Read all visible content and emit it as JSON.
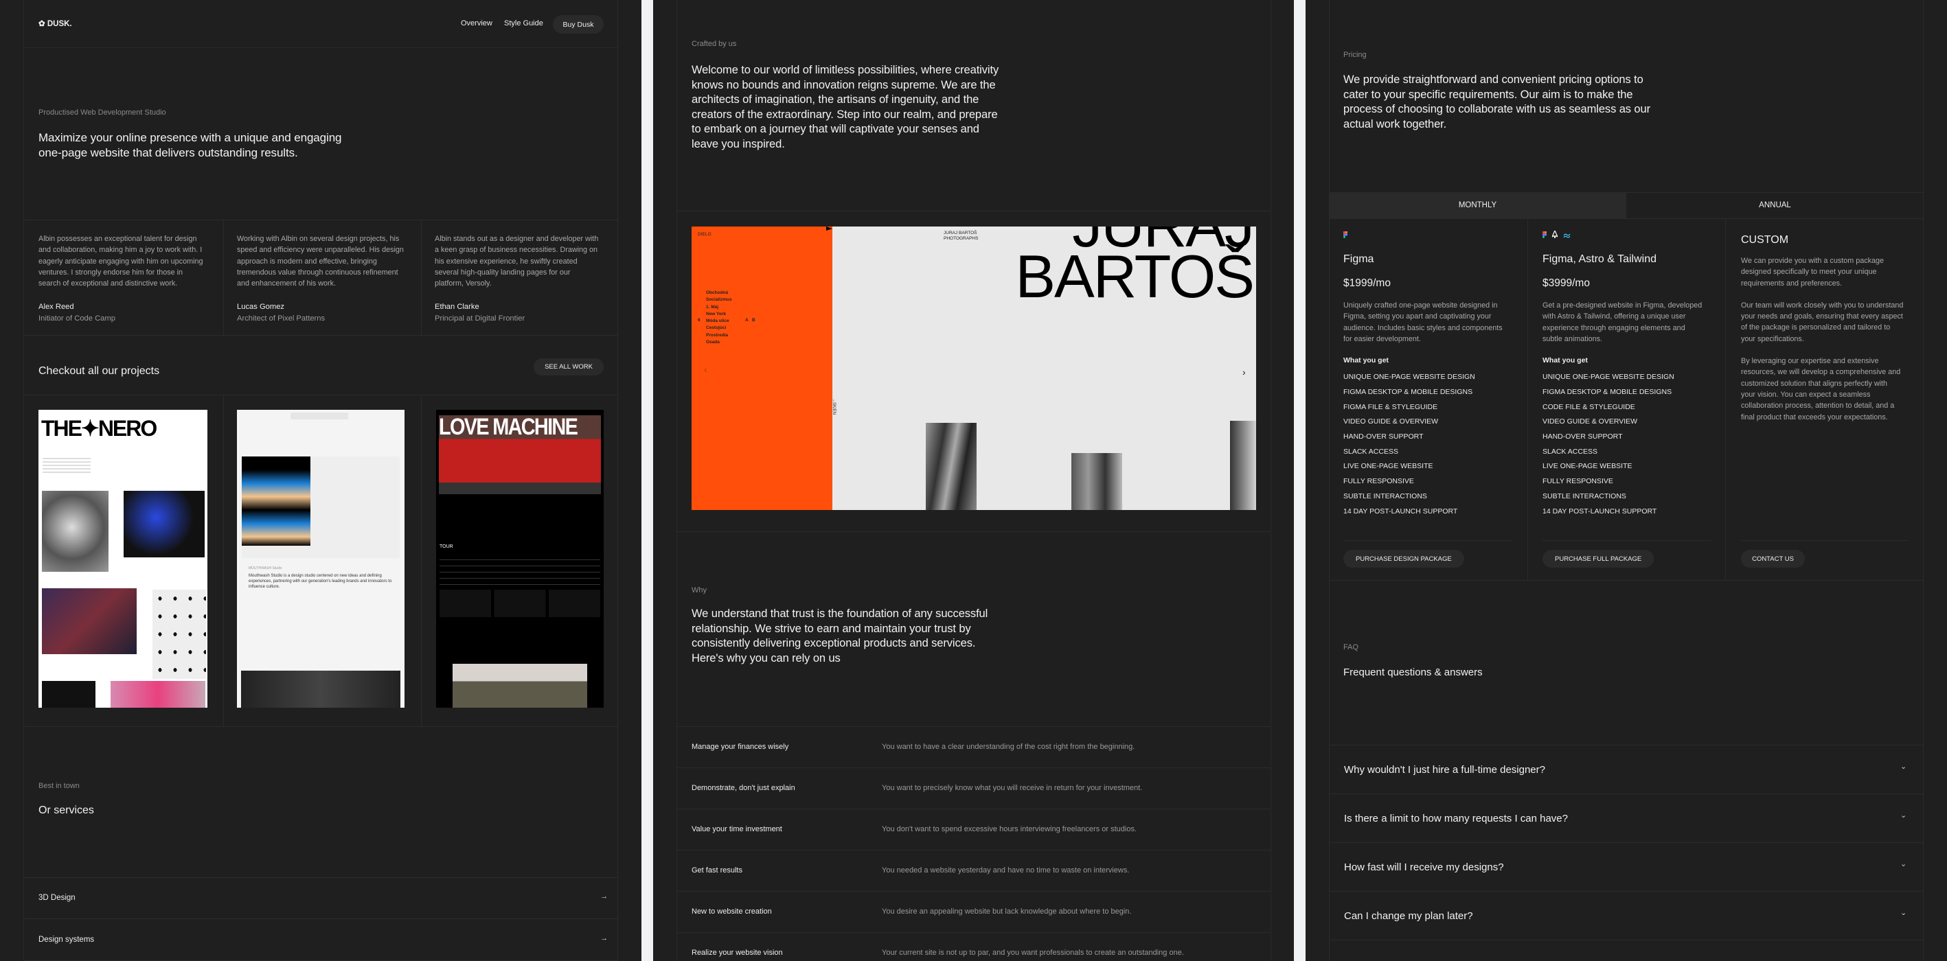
{
  "panel1": {
    "nav": {
      "logo": "✿ DUSK.",
      "links": [
        "Overview",
        "Style Guide"
      ],
      "cta": "Buy Dusk"
    },
    "hero": {
      "eyebrow": "Productised Web Development Studio",
      "headline_lines": [
        "Maximize your online presence with a unique and engaging",
        "one-page website that delivers outstanding results."
      ]
    },
    "testimonials": [
      {
        "lines": [
          "Albin possesses an exceptional talent for design",
          "and collaboration, making him a joy to work with. I",
          "eagerly anticipate engaging with him on upcoming",
          "ventures. I strongly endorse him for those in",
          "search of exceptional and distinctive work."
        ],
        "name": "Alex Reed",
        "role": "Initiator of Code Camp"
      },
      {
        "lines": [
          "Working with Albin on several design projects, his",
          "speed and efficiency were unparalleled. His design",
          "approach is modern and effective, bringing",
          "tremendous value through continuous refinement",
          "and enhancement of his work."
        ],
        "name": "Lucas Gomez",
        "role": "Architect of Pixel Patterns"
      },
      {
        "lines": [
          "Albin stands out as a designer and developer with",
          "a keen grasp of business necessities. Drawing on",
          "his extensive experience, he swiftly created",
          "several high-quality landing pages for our",
          "platform, Versoly."
        ],
        "name": "Ethan Clarke",
        "role": "Principal at Digital Frontier"
      }
    ],
    "projects": {
      "title": "Checkout all our projects",
      "see_all": "SEE ALL WORK",
      "items": [
        {
          "title": "THE✦NERO"
        },
        {
          "title": "Mouthwash Studio is a design studio centered on new ideas and defining experiences, partnering with our generation's leading brands and innovators to influence culture.",
          "label": "MOUTHWASH Studio"
        },
        {
          "title": "LOVE MACHINE",
          "tour": "TOUR"
        }
      ]
    },
    "services": {
      "eyebrow": "Best in town",
      "title": "Or services",
      "items": [
        "3D Design",
        "Design systems"
      ]
    }
  },
  "panel2": {
    "crafted": {
      "eyebrow": "Crafted by us",
      "lines": [
        "Welcome to our world of limitless possibilities, where creativity",
        "knows no bounds and innovation reigns supreme. We are the",
        "architects of imagination, the artisans of ingenuity, and the",
        "creators of the extraordinary. Step into our realm, and prepare",
        "to embark on a journey that will captivate your senses and",
        "leave you inspired."
      ]
    },
    "showcase": {
      "brand": "DIELO",
      "menu": [
        "Obchodná",
        "Socializmus",
        "1. Máj",
        "New York",
        "Móda ulice",
        "Cestujúci",
        "Prostredia",
        "Osada"
      ],
      "count": "6",
      "ab": "A   B",
      "subtitle_lines": [
        "JURAJ BARTOŠ",
        "PHOTOGRAPHS"
      ],
      "big_lines": [
        "JURAJ",
        "BARTOŠ"
      ],
      "lang": "→SK/EN",
      "accent": "#ff4f0a"
    },
    "why": {
      "eyebrow": "Why",
      "lines": [
        "We understand that trust is the foundation of any successful",
        "relationship. We strive to earn and maintain your trust by",
        "consistently delivering exceptional products and services.",
        "Here's why you can rely on us"
      ],
      "rows": [
        {
          "title": "Manage your finances wisely",
          "text": "You want to have a clear understanding of the cost right from the beginning."
        },
        {
          "title": "Demonstrate, don't just explain",
          "text": "You want to precisely know what you will receive in return for your investment."
        },
        {
          "title": "Value your time investment",
          "text": "You don't want to spend excessive hours interviewing freelancers or studios."
        },
        {
          "title": "Get fast results",
          "text": "You needed a website yesterday and have no time to waste on interviews."
        },
        {
          "title": "New to website creation",
          "text": "You desire an appealing website but lack knowledge about where to begin."
        },
        {
          "title": "Realize your website vision",
          "text": "Your current site is not up to par, and you want professionals to create an outstanding one."
        }
      ]
    }
  },
  "panel3": {
    "pricing": {
      "eyebrow": "Pricing",
      "lines": [
        "We provide straightforward and convenient pricing options to",
        "cater to your specific requirements. Our aim is to make the",
        "process of choosing to collaborate with us as seamless as our",
        "actual work together."
      ],
      "tabs": [
        "MONTHLY",
        "ANNUAL"
      ],
      "active_tab": "MONTHLY"
    },
    "plans": [
      {
        "icons": [
          "figma-icon"
        ],
        "name": "Figma",
        "price": "$1999/mo",
        "desc": [
          "Uniquely crafted one-page website designed in",
          "Figma, setting you apart and captivating your",
          "audience. Includes basic styles and components",
          "for easier development."
        ],
        "what": "What you get",
        "features": [
          "UNIQUE ONE-PAGE WEBSITE DESIGN",
          "FIGMA DESKTOP & MOBILE DESIGNS",
          "FIGMA FILE & STYLEGUIDE",
          "VIDEO GUIDE & OVERVIEW",
          "HAND-OVER SUPPORT",
          "SLACK ACCESS",
          "LIVE ONE-PAGE WEBSITE",
          "FULLY RESPONSIVE",
          "SUBTLE INTERACTIONS",
          "14 DAY POST-LAUNCH SUPPORT"
        ],
        "cta": "PURCHASE DESIGN PACKAGE"
      },
      {
        "icons": [
          "figma-icon",
          "astro-icon",
          "tailwind-icon"
        ],
        "name": "Figma, Astro & Tailwind",
        "price": "$3999/mo",
        "desc": [
          "Get a pre-designed website in Figma, developed",
          "with Astro & Tailwind, offering a unique user",
          "experience through engaging elements and",
          "subtle animations."
        ],
        "what": "What you get",
        "features": [
          "UNIQUE ONE-PAGE WEBSITE DESIGN",
          "FIGMA DESKTOP & MOBILE DESIGNS",
          "CODE FILE & STYLEGUIDE",
          "VIDEO GUIDE & OVERVIEW",
          "HAND-OVER SUPPORT",
          "SLACK ACCESS",
          "LIVE ONE-PAGE WEBSITE",
          "FULLY RESPONSIVE",
          "SUBTLE INTERACTIONS",
          "14 DAY POST-LAUNCH SUPPORT"
        ],
        "cta": "PURCHASE FULL PACKAGE"
      }
    ],
    "custom": {
      "name": "CUSTOM",
      "paragraphs": [
        [
          "We can provide you with a custom package",
          "designed specifically to meet your unique",
          "requirements and preferences."
        ],
        [
          "Our team will work closely with you to understand",
          "your needs and goals, ensuring that every aspect",
          "of the package is personalized and tailored to",
          "your specifications."
        ],
        [
          "By leveraging our expertise and extensive",
          "resources, we will develop a comprehensive and",
          "customized solution that aligns perfectly with",
          "your vision. You can expect a seamless",
          "collaboration process, attention to detail, and a",
          "final product that exceeds your expectations."
        ]
      ],
      "cta": "CONTACT US"
    },
    "faq": {
      "eyebrow": "FAQ",
      "title": "Frequent questions & answers",
      "questions": [
        "Why wouldn't I just hire a full-time designer?",
        "Is there a limit to how many requests I can have?",
        "How fast will I receive my designs?",
        "Can I change my plan later?"
      ]
    }
  }
}
